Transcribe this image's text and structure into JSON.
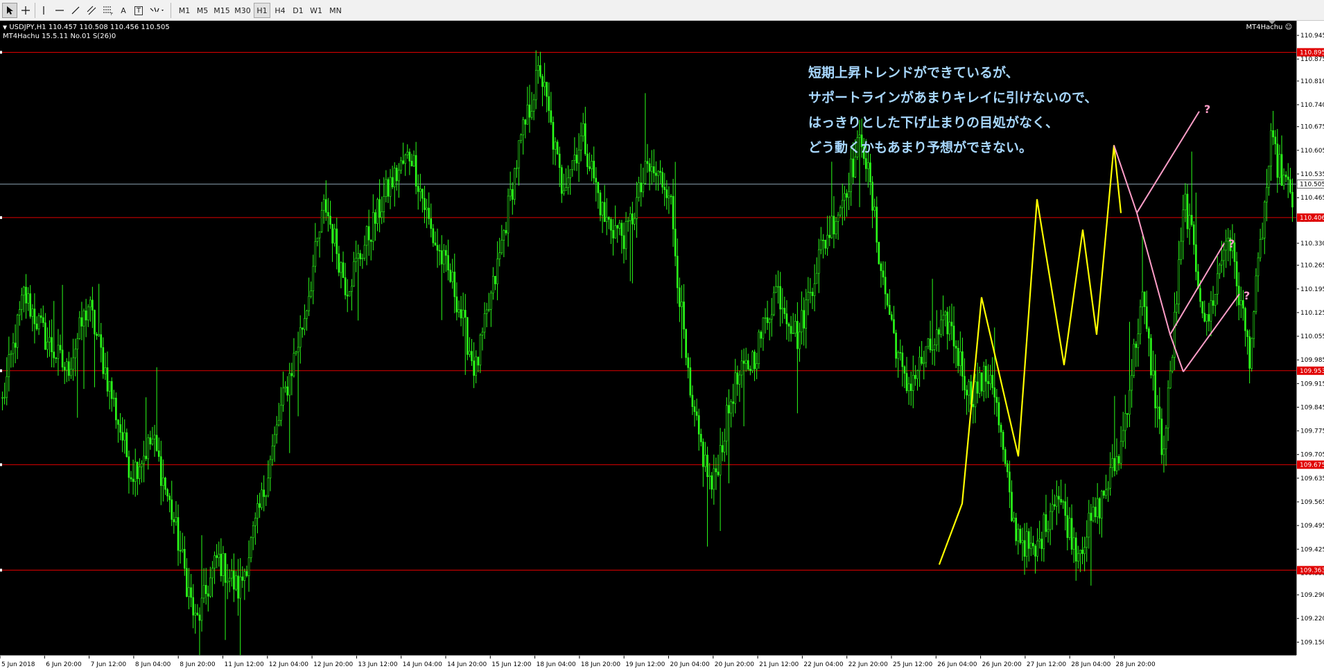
{
  "toolbar": {
    "tools": [
      {
        "name": "cursor-arrow",
        "icon": "arrow-icon"
      },
      {
        "name": "crosshair",
        "icon": "crosshair-icon"
      },
      {
        "name": "vertical-line",
        "icon": "vertical-line-icon"
      },
      {
        "name": "horizontal-line",
        "icon": "horizontal-line-icon"
      },
      {
        "name": "trendline",
        "icon": "trendline-icon"
      },
      {
        "name": "equidistant-channel",
        "icon": "channel-icon"
      },
      {
        "name": "fibonacci",
        "icon": "fibonacci-icon"
      },
      {
        "name": "text",
        "label": "A",
        "icon": "text-icon"
      },
      {
        "name": "text-label",
        "label": "T",
        "icon": "text-label-icon"
      },
      {
        "name": "arrows-menu",
        "icon": "arrows-dropdown-icon"
      }
    ],
    "timeframes": [
      "M1",
      "M5",
      "M15",
      "M30",
      "H1",
      "H4",
      "D1",
      "W1",
      "MN"
    ],
    "active_timeframe": "H1"
  },
  "chart_info": {
    "symbol_line": "USDJPY,H1  110.457 110.508 110.456 110.505",
    "indicator_line": "MT4Hachu 15.5.11    No.01  S(26)0",
    "ea_label": "MT4Hachu ☺"
  },
  "annotation": {
    "lines": [
      "短期上昇トレンドができているが、",
      "サポートラインがあまりキレイに引けないので、",
      "はっきりとした下げ止まりの目処がなく、",
      "どう動くかもあまり予想ができない。"
    ],
    "question_marks": [
      "?",
      "?",
      "?"
    ]
  },
  "colors": {
    "background": "#000000",
    "candle": "#2bff1a",
    "level_line": "#e00000",
    "current_price_line": "#8aa0b0",
    "zigzag": "#ffff00",
    "forecast": "#ff9ec8",
    "annotation_text": "#a8d8ff"
  },
  "chart_data": {
    "type": "candlestick",
    "symbol": "USDJPY",
    "timeframe": "H1",
    "ylim": [
      109.12,
      110.98
    ],
    "price_ticks": [
      "110.945",
      "110.875",
      "110.810",
      "110.740",
      "110.675",
      "110.605",
      "110.535",
      "110.465",
      "110.400",
      "110.330",
      "110.265",
      "110.195",
      "110.125",
      "110.055",
      "109.985",
      "109.915",
      "109.845",
      "109.775",
      "109.705",
      "109.635",
      "109.565",
      "109.495",
      "109.425",
      "109.355",
      "109.290",
      "109.220",
      "109.150"
    ],
    "current_price": "110.505",
    "levels": [
      {
        "price": 110.895,
        "label": "110.895"
      },
      {
        "price": 110.406,
        "label": "110.406"
      },
      {
        "price": 109.953,
        "label": "109.953"
      },
      {
        "price": 109.675,
        "label": "109.675"
      },
      {
        "price": 109.363,
        "label": "109.363"
      }
    ],
    "time_labels": [
      "5 Jun 2018",
      "6 Jun 20:00",
      "7 Jun 12:00",
      "8 Jun 04:00",
      "8 Jun 20:00",
      "11 Jun 12:00",
      "12 Jun 04:00",
      "12 Jun 20:00",
      "13 Jun 12:00",
      "14 Jun 04:00",
      "14 Jun 20:00",
      "15 Jun 12:00",
      "18 Jun 04:00",
      "18 Jun 20:00",
      "19 Jun 12:00",
      "20 Jun 04:00",
      "20 Jun 20:00",
      "21 Jun 12:00",
      "22 Jun 04:00",
      "22 Jun 20:00",
      "25 Jun 12:00",
      "26 Jun 04:00",
      "26 Jun 20:00",
      "27 Jun 12:00",
      "28 Jun 04:00",
      "28 Jun 20:00"
    ],
    "close_path": [
      109.86,
      110.18,
      110.05,
      109.95,
      110.15,
      109.9,
      109.65,
      109.75,
      109.5,
      109.2,
      109.4,
      109.3,
      109.55,
      109.85,
      110.1,
      110.45,
      110.2,
      110.35,
      110.5,
      110.6,
      110.35,
      110.2,
      109.95,
      110.25,
      110.6,
      110.85,
      110.5,
      110.65,
      110.4,
      110.35,
      110.55,
      110.5,
      109.85,
      109.6,
      109.9,
      110.0,
      110.2,
      110.05,
      110.3,
      110.45,
      110.65,
      110.2,
      109.9,
      110.0,
      110.1,
      109.88,
      109.95,
      109.5,
      109.4,
      109.6,
      109.42,
      109.55,
      109.72,
      110.17,
      109.7,
      110.46,
      110.08,
      110.37,
      110.0,
      110.62,
      110.45
    ],
    "zigzag": [
      [
        109.38,
        109.56,
        110.17,
        109.7,
        110.46,
        109.97,
        110.37,
        110.06,
        110.62,
        110.42
      ]
    ],
    "forecasts": [
      {
        "from": 110.42,
        "to": 110.72
      },
      {
        "from": 110.06,
        "to": 110.33
      },
      {
        "from": 109.95,
        "to": 110.18
      }
    ]
  }
}
